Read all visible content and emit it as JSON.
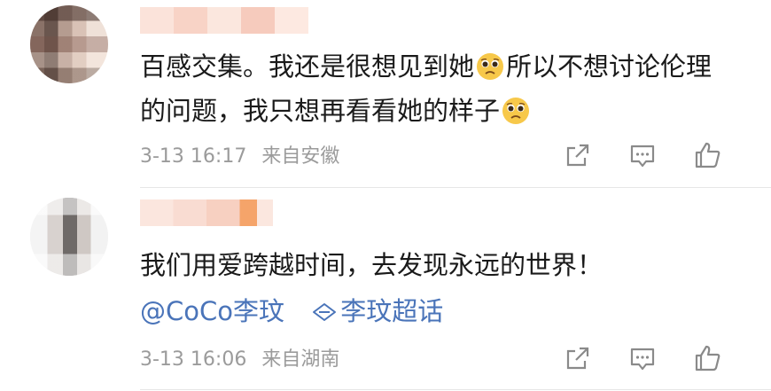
{
  "comments": [
    {
      "text_before_emoji_1": "百感交集。我还是很想见到她",
      "text_between_emojis": "所以不想讨论伦理的问题，我只想再看看她的样子",
      "emoji": "pleading-face-icon",
      "date": "3-13 16:17",
      "location": "来自安徽"
    },
    {
      "text": "我们用爱跨越时间，去发现永远的世界！",
      "mention": "@CoCo李玟",
      "topic": "李玟超话",
      "date": "3-13 16:06",
      "location": "来自湖南"
    }
  ],
  "icons": {
    "share": "share-icon",
    "comment": "comment-icon",
    "like": "thumbs-up-icon",
    "topic": "super-topic-diamond-icon"
  },
  "colors": {
    "link": "#4a74b9",
    "meta": "#9b9b9b",
    "text": "#1a1a1a"
  }
}
